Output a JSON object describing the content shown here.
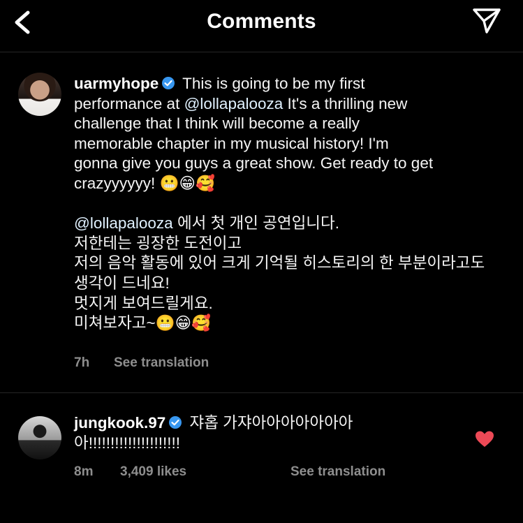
{
  "header": {
    "title": "Comments"
  },
  "comments": [
    {
      "username": "uarmyhope",
      "text_line1": " This is going to be my first",
      "text_line2a": "performance at ",
      "mention": "@lollapalooza",
      "text_line2b": " It's a thrilling new",
      "text_line3": "challenge that I think will become a really",
      "text_line4": "memorable chapter in my musical history! I'm",
      "text_line5": "gonna give you guys a great show. Get ready to get",
      "text_line6": "crazyyyyyy! 😬😁🥰",
      "ko_mention": "@lollapalooza",
      "ko_line1": " 에서 첫 개인 공연입니다.",
      "ko_line2": "저한테는 굉장한 도전이고",
      "ko_line3": "저의 음악 활동에 있어 크게 기억될 히스토리의 한 부분이라고도",
      "ko_line4": "생각이 드네요!",
      "ko_line5": "멋지게 보여드릴게요.",
      "ko_line6": "미쳐보자고~😬😁🥰",
      "time": "7h",
      "translate": "See translation"
    },
    {
      "username": "jungkook.97",
      "line1": " 쟈홉 가쟈아아아아아아아",
      "line2": "아!!!!!!!!!!!!!!!!!!!!!",
      "time": "8m",
      "likes": "3,409 likes",
      "translate": "See translation"
    }
  ],
  "colors": {
    "verified": "#3897f0",
    "heart": "#ed4956",
    "muted": "#8e8e8e"
  }
}
